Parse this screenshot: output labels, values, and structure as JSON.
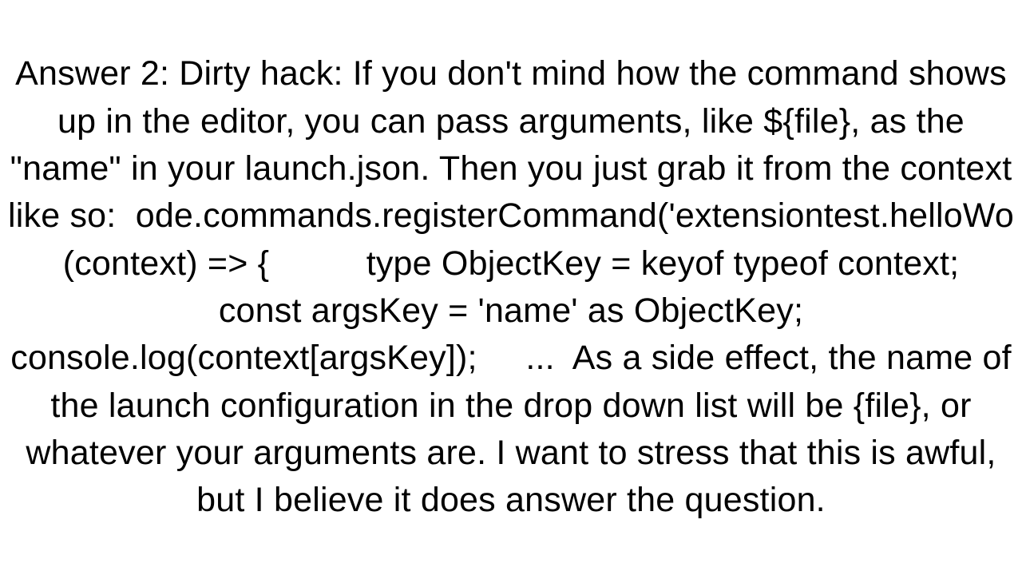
{
  "answer": {
    "text": "Answer 2: Dirty hack: If you don't mind how the command shows up in the editor, you can pass arguments, like ${file}, as the \"name\" in your launch.json. Then you just grab it from the context like so:  ode.commands.registerCommand('extensiontest.helloWo (context) => {          type ObjectKey = keyof typeof context;     const argsKey = 'name' as ObjectKey;     console.log(context[argsKey]);     ...  As a side effect, the name of the launch configuration in the drop down list will be {file}, or whatever your arguments are. I want to stress that this is awful, but I believe it does answer the question."
  }
}
